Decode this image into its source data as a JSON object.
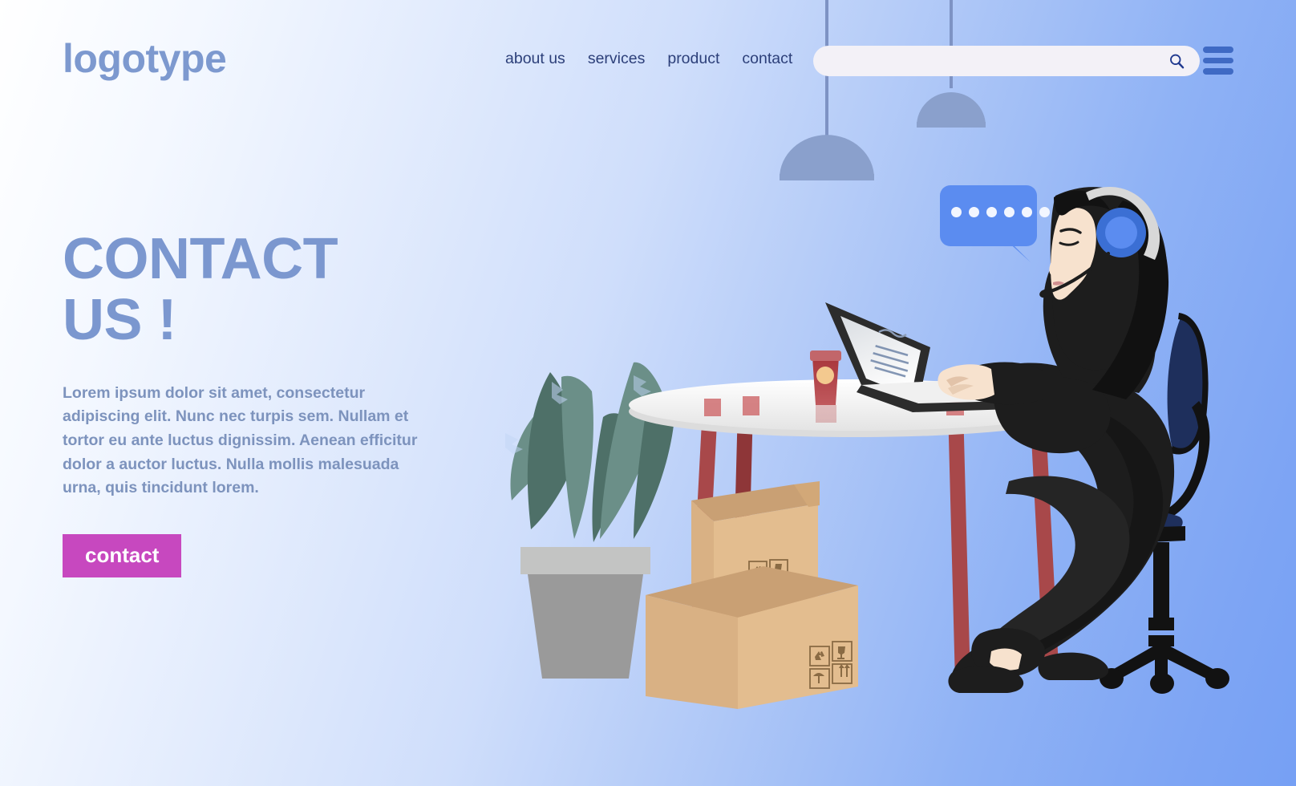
{
  "header": {
    "logotype": "logotype",
    "nav_items": [
      {
        "label": "about us"
      },
      {
        "label": "services"
      },
      {
        "label": "product"
      },
      {
        "label": "contact"
      }
    ],
    "search": {
      "value": "",
      "placeholder": "",
      "icon": "search-icon"
    },
    "menu_icon": "hamburger-menu-icon"
  },
  "hero": {
    "headline": "CONTACT\nUS !",
    "paragraph": "Lorem ipsum dolor sit amet, consectetur adipiscing elit. Nunc nec turpis sem. Nullam et tortor eu ante luctus dignissim. Aenean efficitur dolor a auctor luctus. Nulla mollis malesuada urna, quis tincidunt lorem.",
    "cta_label": "contact"
  },
  "illustration": {
    "description": "Woman with headset at round table working on laptop, shipping boxes, potted plant, pendant lamps, chat bubble",
    "chat_bubble": {
      "dot_count": 6
    },
    "box_symbols": [
      "recycle",
      "fragile-glass",
      "keep-dry-umbrella",
      "this-side-up"
    ],
    "lamp_count": 2
  },
  "colors": {
    "background_light": "#ffffff",
    "background_blue": "#76a0f4",
    "logotype": "#7d99cf",
    "nav_text": "#2c3f79",
    "headline": "#7b97cf",
    "paragraph": "#7d93bd",
    "cta_background": "#c748bf",
    "cta_text": "#ffffff",
    "hamburger": "#3f6ac4",
    "search_background": "#f3f1f7",
    "chat_bubble": "#5b8cf0",
    "lamp_shade": "#8aa0cc",
    "table_top": "#f0f0f0",
    "table_leg": "#a8484a",
    "chair": "#1e2f5c",
    "outfit": "#1d1d1d",
    "skin": "#f7e0cc",
    "headphone": "#4a86e8",
    "box_front": "#e3bd8f",
    "box_top": "#c9a074",
    "plant_leaf_dark": "#4e7068",
    "plant_leaf_light": "#6b8f88",
    "pot": "#9a9a9a",
    "coffee_cup": "#a8363c"
  }
}
